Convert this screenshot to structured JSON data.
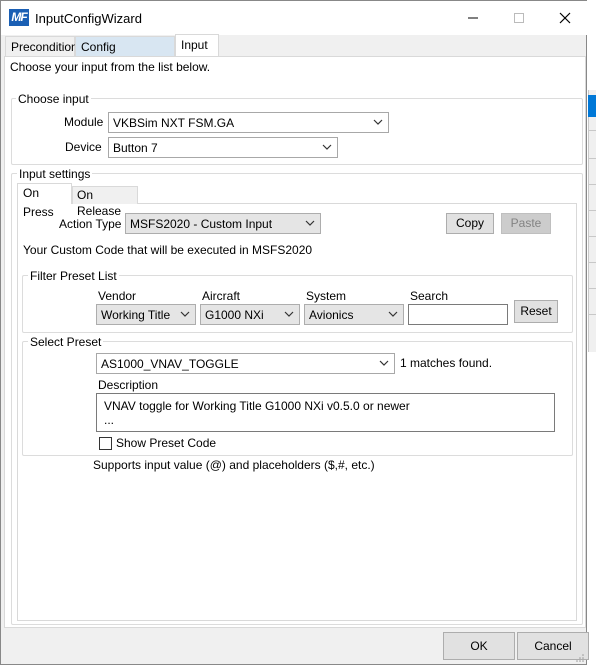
{
  "window": {
    "title": "InputConfigWizard",
    "logo_text": "MF"
  },
  "tabs": [
    {
      "label": "Precondition"
    },
    {
      "label": "Config References"
    },
    {
      "label": "Input"
    }
  ],
  "input_tab": {
    "instruction": "Choose your input from the list below.",
    "choose_input": {
      "legend": "Choose input",
      "module_label": "Module",
      "module_value": "VKBSim NXT FSM.GA",
      "device_label": "Device",
      "device_value": "Button 7"
    },
    "input_settings": {
      "legend": "Input settings",
      "subtabs": [
        {
          "label": "On Press"
        },
        {
          "label": "On Release"
        }
      ],
      "action_type_label": "Action Type",
      "action_type_value": "MSFS2020 - Custom Input",
      "copy_label": "Copy",
      "paste_label": "Paste",
      "custom_code_text": "Your Custom Code that will be executed in MSFS2020",
      "filter": {
        "legend": "Filter Preset List",
        "vendor_label": "Vendor",
        "vendor_value": "Working Title",
        "aircraft_label": "Aircraft",
        "aircraft_value": "G1000 NXi",
        "system_label": "System",
        "system_value": "Avionics",
        "search_label": "Search",
        "search_value": "",
        "reset_label": "Reset"
      },
      "select_preset": {
        "legend": "Select Preset",
        "preset_value": "AS1000_VNAV_TOGGLE",
        "matches_text": "1 matches found.",
        "description_label": "Description",
        "description_line1": "VNAV toggle for Working Title G1000 NXi v0.5.0 or newer",
        "description_line2": "...",
        "show_code_label": "Show Preset Code"
      },
      "supports_text": "Supports input value (@) and placeholders ($,#, etc.)"
    }
  },
  "footer": {
    "ok_label": "OK",
    "cancel_label": "Cancel"
  }
}
